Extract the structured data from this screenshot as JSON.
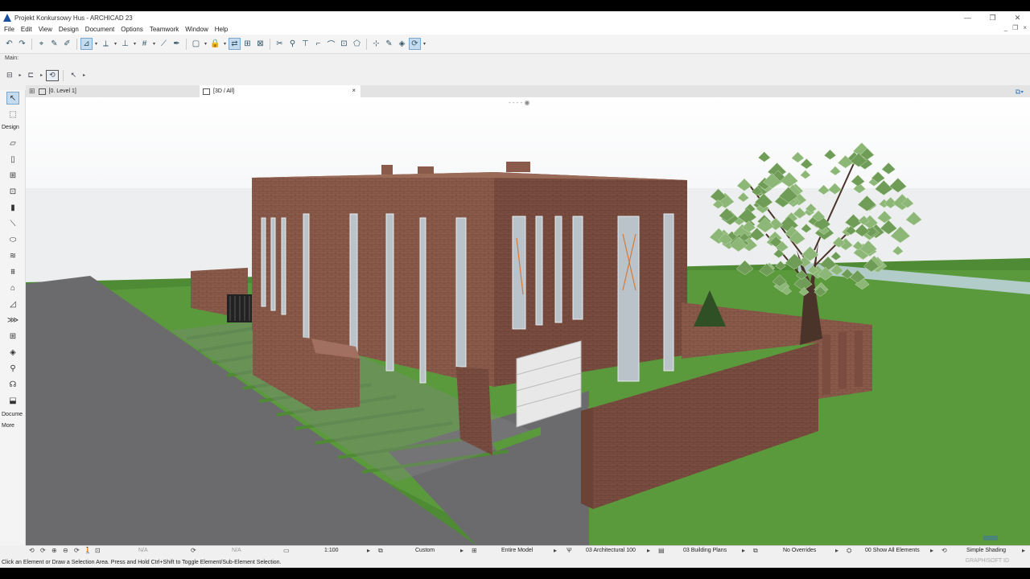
{
  "window": {
    "title": "Projekt Konkursowy Hus - ARCHICAD 23",
    "minimize": "—",
    "maximize": "❐",
    "close": "✕"
  },
  "menu": [
    "File",
    "Edit",
    "View",
    "Design",
    "Document",
    "Options",
    "Teamwork",
    "Window",
    "Help"
  ],
  "toolbar": {
    "main_label": "Main:"
  },
  "tabs": {
    "plan": "[0. Level 1]",
    "threed": "[3D / All]",
    "close": "×"
  },
  "toolbox": {
    "design_label": "Design",
    "document_label": "Docume",
    "more_label": "More"
  },
  "bottom": {
    "na1": "N/A",
    "na2": "N/A",
    "scale": "1:100",
    "custom": "Custom",
    "entire_model": "Entire Model",
    "pen_set": "03 Architectural 100",
    "model_view": "03 Building Plans",
    "overrides": "No Overrides",
    "renovation": "00 Show All Elements",
    "shading": "Simple Shading"
  },
  "status": {
    "message": "Click an Element or Draw a Selection Area. Press and Hold Ctrl+Shift to Toggle Element/Sub-Element Selection.",
    "brand": "GRAPHISOFT ID"
  },
  "colors": {
    "brick": "#8a5a4a",
    "grass": "#4f8a35",
    "road": "#6b6b6e",
    "accent": "#c5dbef"
  }
}
